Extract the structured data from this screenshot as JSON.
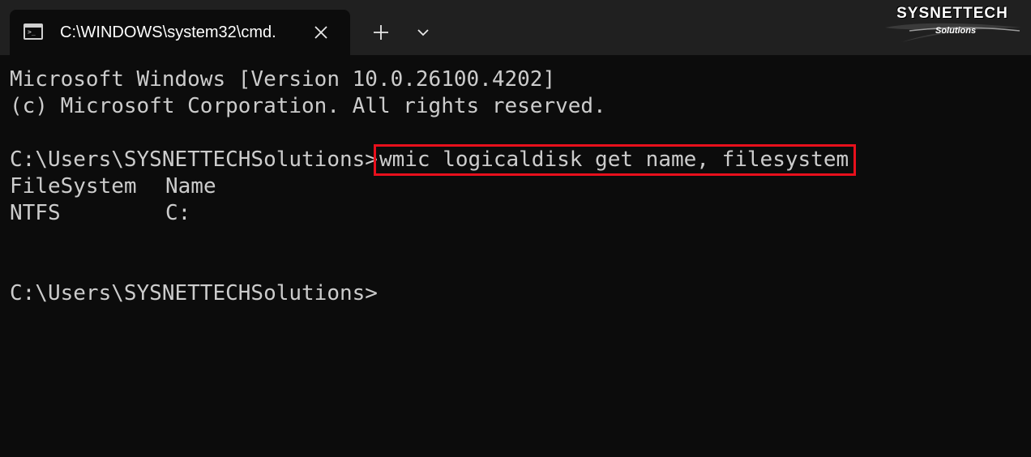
{
  "tab": {
    "title": "C:\\WINDOWS\\system32\\cmd.",
    "icon": "cmd-icon",
    "icon_prompt": ">_",
    "close_icon": "close-icon"
  },
  "tabstrip": {
    "new_tab_icon": "plus-icon",
    "dropdown_icon": "chevron-down-icon"
  },
  "logo": {
    "main": "SYSNETTECH",
    "sub": "Solutions"
  },
  "terminal": {
    "header": [
      "Microsoft Windows [Version 10.0.26100.4202]",
      "(c) Microsoft Corporation. All rights reserved."
    ],
    "prompt": "C:\\Users\\SYSNETTECHSolutions>",
    "command": "wmic logicaldisk get name, filesystem",
    "output_headers": [
      "FileSystem",
      "Name"
    ],
    "output_rows": [
      [
        "NTFS",
        "C:"
      ]
    ],
    "final_prompt": "C:\\Users\\SYSNETTECHSolutions>"
  },
  "colors": {
    "background": "#0c0c0c",
    "titlebar": "#202020",
    "text": "#cccccc",
    "highlight": "#e8101c"
  }
}
